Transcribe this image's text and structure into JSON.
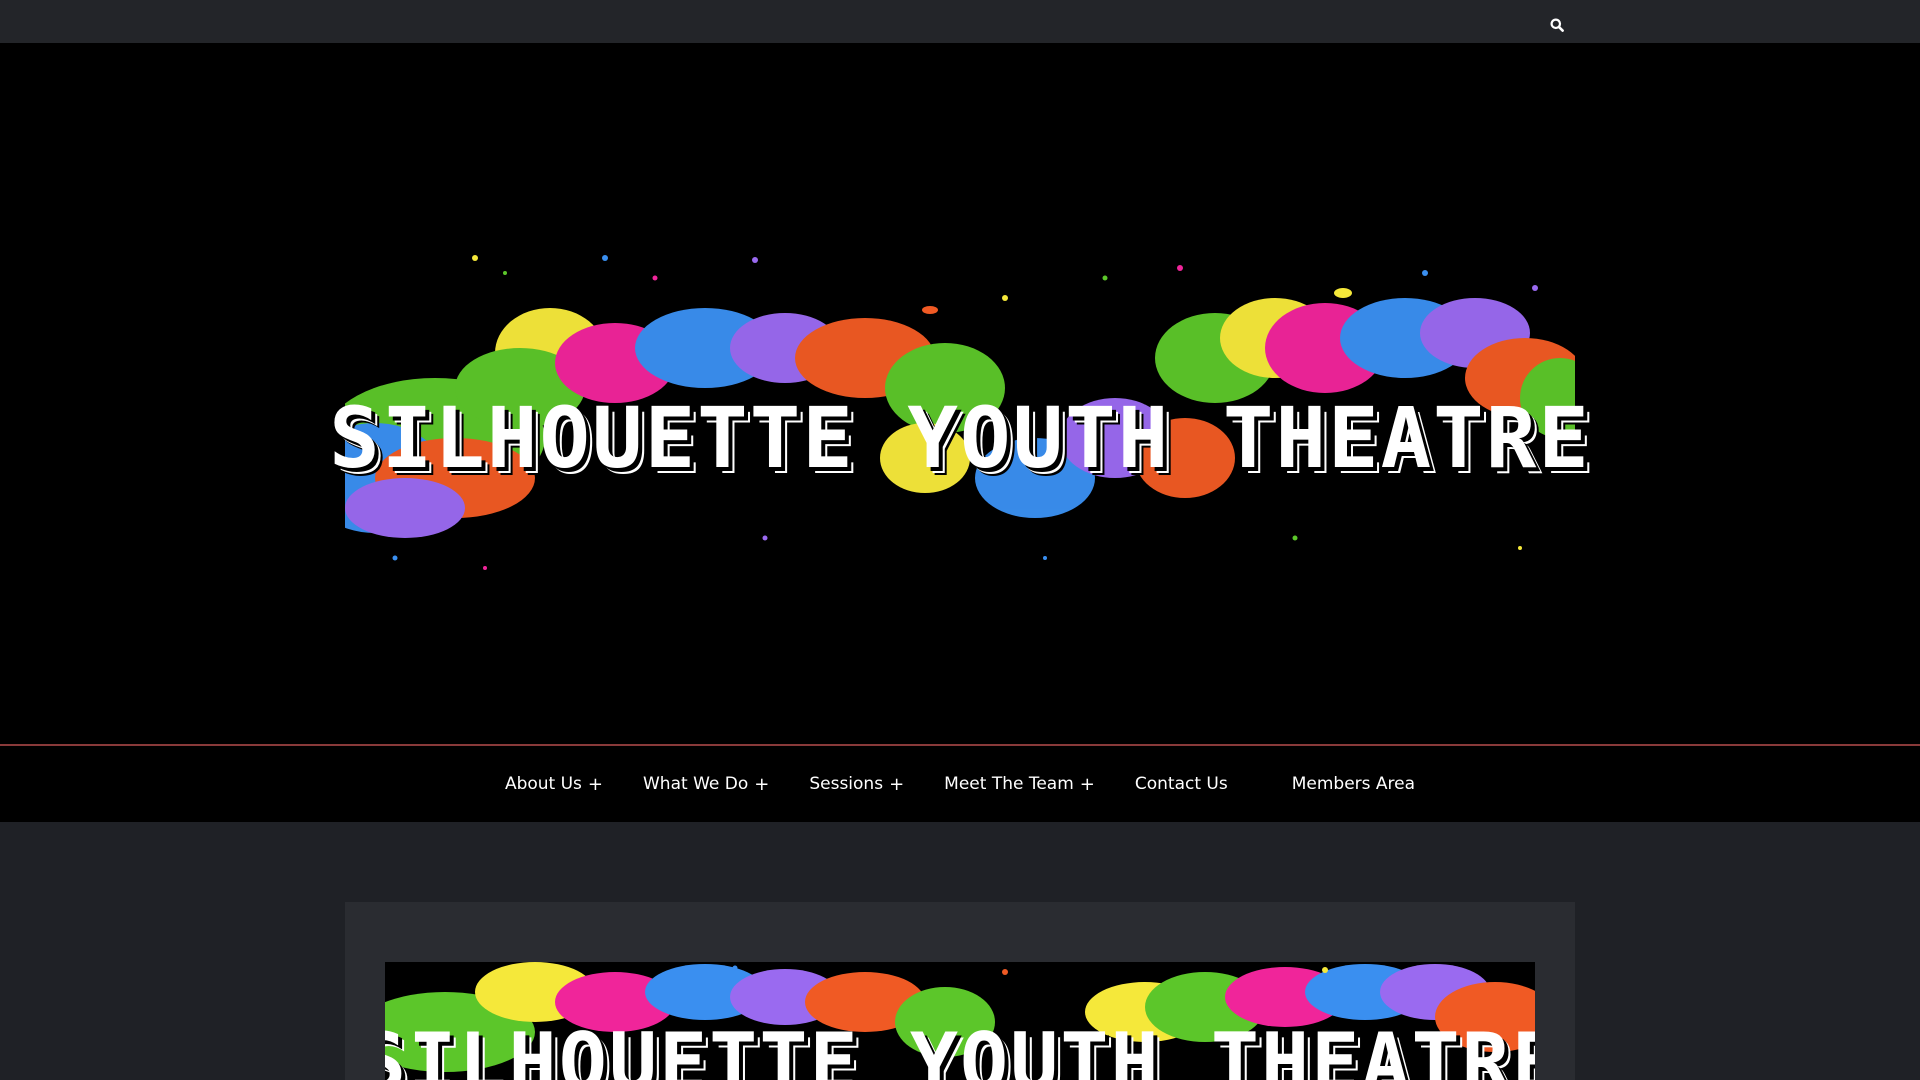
{
  "topbar": {
    "search_icon": "search-icon"
  },
  "header": {
    "logo_text": "SILHOUETTE YOUTH THEATRE"
  },
  "nav": {
    "items": [
      {
        "label": "About Us",
        "has_submenu": true,
        "plus": "+"
      },
      {
        "label": "What We Do",
        "has_submenu": true,
        "plus": "+"
      },
      {
        "label": "Sessions",
        "has_submenu": true,
        "plus": "+"
      },
      {
        "label": "Meet The Team",
        "has_submenu": true,
        "plus": "+"
      },
      {
        "label": "Contact Us",
        "has_submenu": false
      },
      {
        "label": "Members Area",
        "has_submenu": false
      }
    ]
  },
  "content": {
    "banner_text": "SILHOUETTE YOUTH THEATRE"
  },
  "colors": {
    "topbar_bg": "#232529",
    "header_bg": "#000000",
    "nav_divider": "#8a3a3a",
    "page_bg": "#1f2126",
    "card_bg": "#2a2c31",
    "splash_green": "#5cc62a",
    "splash_yellow": "#f5e83a",
    "splash_pink": "#f0259a",
    "splash_blue": "#3a8ff0",
    "splash_purple": "#9a6af0",
    "splash_orange": "#f05a24"
  }
}
